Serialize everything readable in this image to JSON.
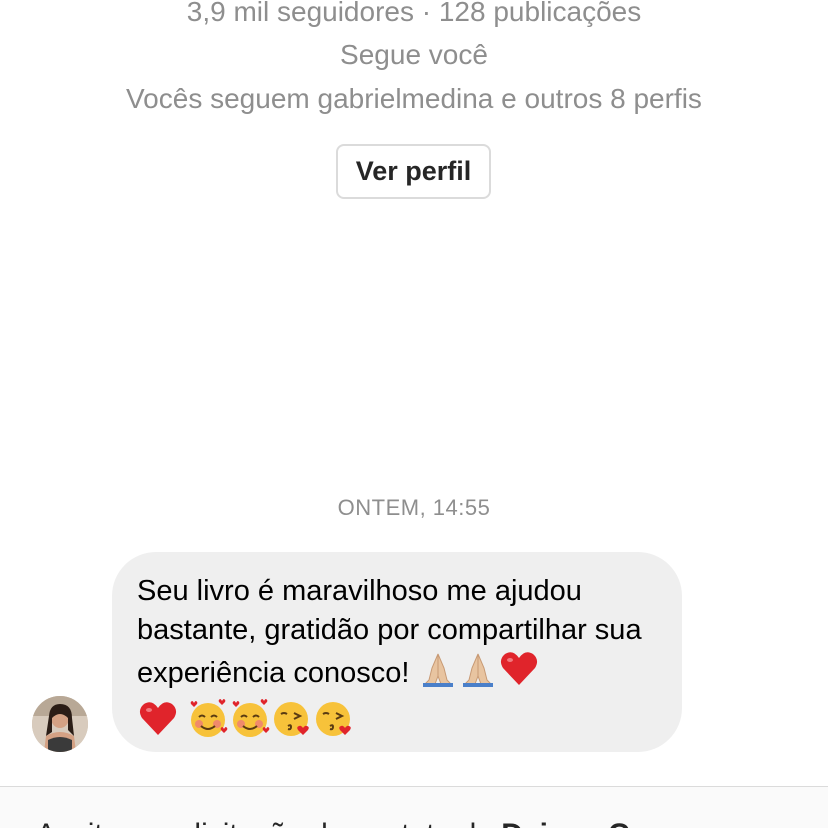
{
  "profile": {
    "stats": "3,9 mil seguidores · 128 publicações",
    "follows_you": "Segue você",
    "mutuals": "Vocês seguem gabrielmedina e outros 8 perfis",
    "view_profile_label": "Ver perfil"
  },
  "conversation": {
    "timestamp": "ONTEM, 14:55",
    "message": {
      "text": "Seu livro é maravilhoso me ajudou bastante, gratidão por compartilhar sua experiência conosco!",
      "emojis": [
        "folded-hands",
        "folded-hands",
        "red-heart",
        "red-heart",
        "smiling-face-with-hearts",
        "smiling-face-with-hearts",
        "face-blowing-kiss",
        "face-blowing-kiss"
      ]
    }
  },
  "request_bar": {
    "text": "Aceitar a solicitação de contato de",
    "name": "Daiane C."
  },
  "colors": {
    "bubble_bg": "#efefef",
    "secondary_text": "#8e8e8e",
    "heart": "#e0242b"
  }
}
